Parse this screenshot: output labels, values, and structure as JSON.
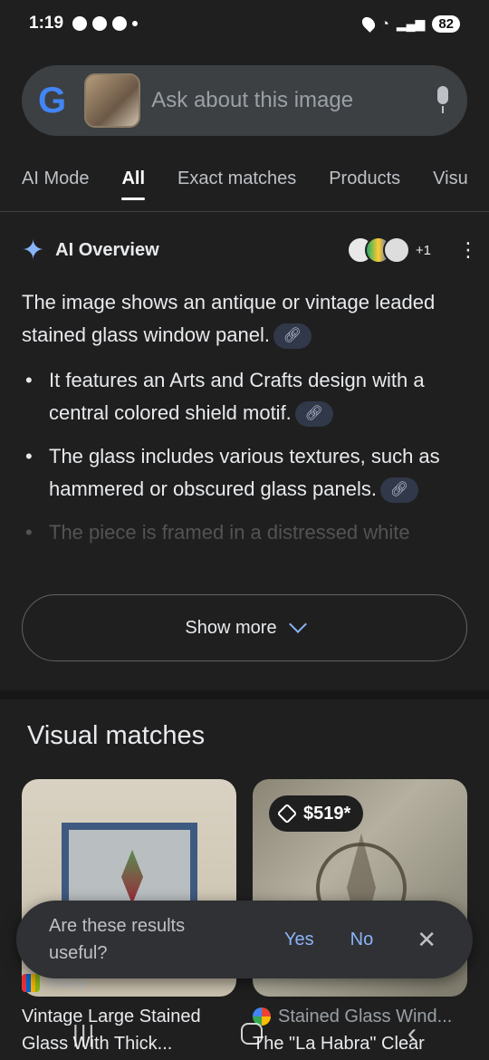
{
  "status_bar": {
    "time": "1:19",
    "battery": "82"
  },
  "search": {
    "placeholder": "Ask about this image"
  },
  "tabs": [
    "AI Mode",
    "All",
    "Exact matches",
    "Products",
    "Visu"
  ],
  "ai_overview": {
    "title": "AI Overview",
    "source_count": "+1",
    "intro": "The image shows an antique or vintage leaded stained glass window panel.",
    "bullets": [
      "It features an Arts and Crafts design with a central colored shield motif.",
      "The glass includes various textures, such as hammered or obscured glass panels.",
      "The piece is framed in a distressed white"
    ],
    "show_more": "Show more"
  },
  "visual_matches": {
    "title": "Visual matches",
    "results": [
      {
        "store": "eBay",
        "title": "Vintage Large Stained Glass With Thick..."
      },
      {
        "price": "$519*",
        "store_title": "Stained Glass Wind...",
        "title": "The \"La Habra\" Clear"
      }
    ]
  },
  "feedback": {
    "question": "Are these results useful?",
    "yes": "Yes",
    "no": "No"
  },
  "colors": {
    "accent": "#8ab4f8",
    "background": "#1f1f1f",
    "search_bg": "#3c4043"
  },
  "icons": [
    "google-logo",
    "mic-icon",
    "sparkle-icon",
    "more-vert-icon",
    "link-icon",
    "chevron-down-icon",
    "tag-icon",
    "close-icon"
  ]
}
